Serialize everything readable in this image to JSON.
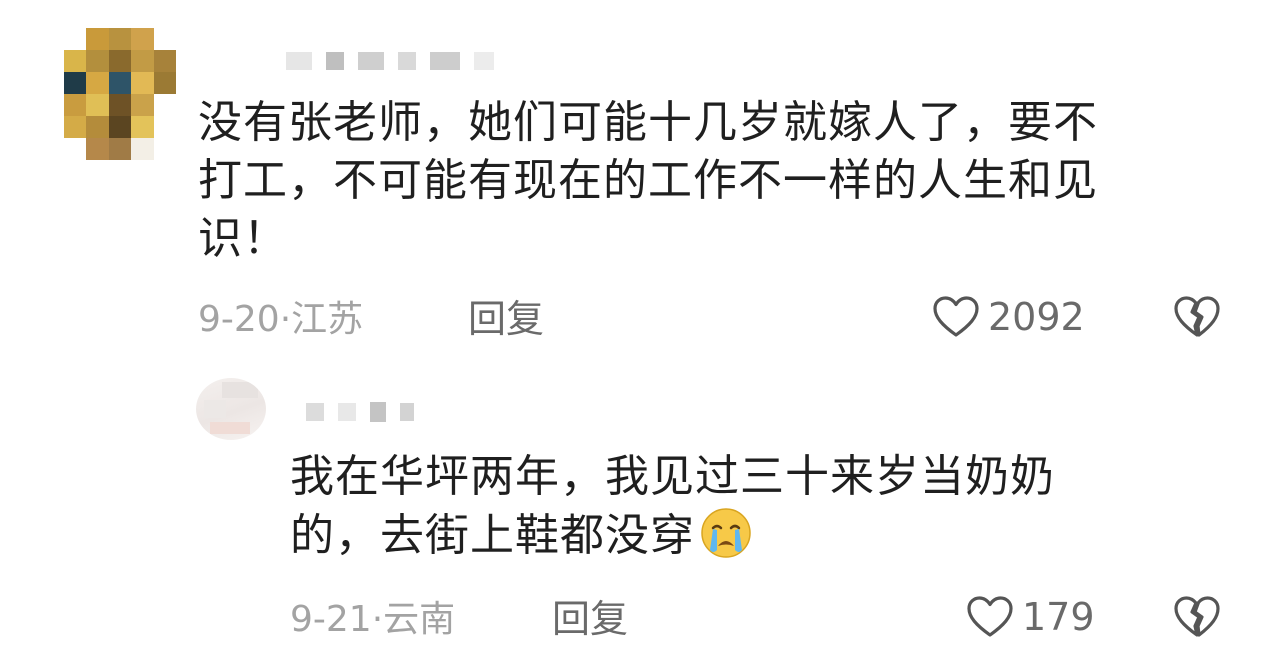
{
  "comments": {
    "main": {
      "text_lines": [
        "没有张老师，她们可能十几岁就嫁人了，要不",
        "打工，不可能有现在的工作不一样的人生和见",
        "识！"
      ],
      "date": "9-20",
      "location": "江苏",
      "separator": "·",
      "reply_label": "回复",
      "likes": "2092",
      "avatar_icon": "pixelated-avatar",
      "like_icon": "heart-outline-icon",
      "dislike_icon": "broken-heart-icon"
    },
    "reply": {
      "text_lines": [
        "我在华坪两年，我见过三十来岁当奶奶",
        "的，去街上鞋都没穿"
      ],
      "emoji": "crying-face-emoji",
      "date": "9-21",
      "location": "云南",
      "separator": "·",
      "reply_label": "回复",
      "likes": "179",
      "avatar_icon": "blurred-avatar",
      "like_icon": "heart-outline-icon",
      "dislike_icon": "broken-heart-icon"
    }
  },
  "colors": {
    "text": "#1f1f1f",
    "meta_text": "#a3a3a3",
    "action_text": "#6a6a6a",
    "icon_stroke": "#555555"
  }
}
